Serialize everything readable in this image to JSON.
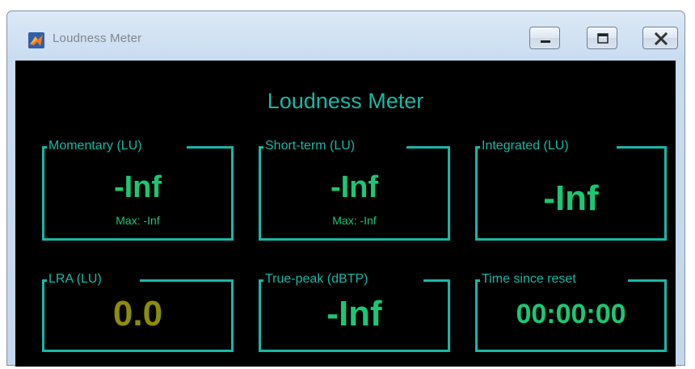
{
  "window": {
    "title": "Loudness Meter",
    "icon": "matlab-icon",
    "buttons": [
      "minimize-icon",
      "maximize-icon",
      "close-icon"
    ]
  },
  "meter": {
    "title": "Loudness Meter",
    "panels": [
      {
        "label": "Momentary (LU)",
        "value": "-Inf",
        "max": "Max: -Inf"
      },
      {
        "label": "Short-term (LU)",
        "value": "-Inf",
        "max": "Max: -Inf"
      },
      {
        "label": "Integrated (LU)",
        "value": "-Inf"
      },
      {
        "label": "LRA (LU)",
        "value": "0.0"
      },
      {
        "label": "True-peak (dBTP)",
        "value": "-Inf"
      },
      {
        "label": "Time since reset",
        "value": "00:00:00"
      }
    ]
  },
  "colors": {
    "accent": "#17b8a6",
    "value_green": "#19c873",
    "value_olive": "#8c8c0a",
    "background": "#000000"
  }
}
